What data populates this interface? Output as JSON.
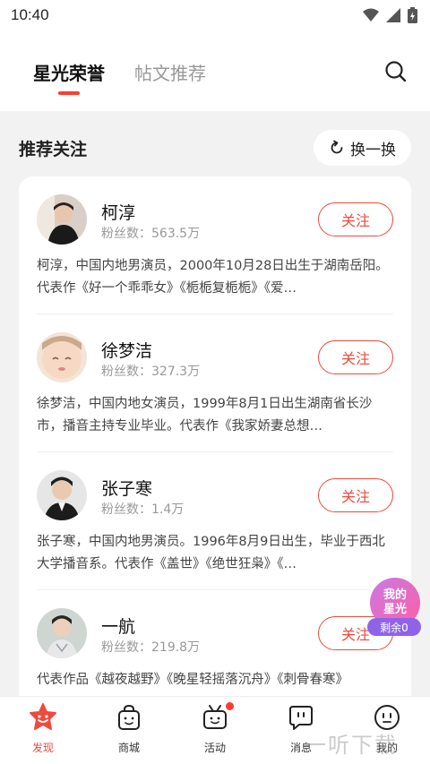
{
  "status_bar": {
    "time": "10:40"
  },
  "header": {
    "tabs": [
      {
        "label": "星光荣誉"
      },
      {
        "label": "帖文推荐"
      }
    ]
  },
  "section": {
    "title": "推荐关注",
    "refresh_label": "换一换"
  },
  "people": [
    {
      "name": "柯淳",
      "fans": "粉丝数：563.5万",
      "follow_label": "关注",
      "bio": "柯淳，中国内地男演员，2000年10月28日出生于湖南岳阳。代表作《好一个乖乖女》《栀栀复栀栀》《爱…"
    },
    {
      "name": "徐梦洁",
      "fans": "粉丝数：327.3万",
      "follow_label": "关注",
      "bio": "徐梦洁，中国内地女演员，1999年8月1日出生湖南省长沙市，播音主持专业毕业。代表作《我家娇妻总想…"
    },
    {
      "name": "张子寒",
      "fans": "粉丝数：1.4万",
      "follow_label": "关注",
      "bio": "张子寒，中国内地男演员。1996年8月9日出生，毕业于西北大学播音系。代表作《盖世》《绝世狂枭》《…"
    },
    {
      "name": "一航",
      "fans": "粉丝数：219.8万",
      "follow_label": "关注",
      "bio": "代表作品《越夜越野》《晚星轻摇落沉舟》《刺骨春寒》"
    }
  ],
  "floating": {
    "title": "我的星光",
    "remain": "剩余0"
  },
  "bottom_nav": [
    {
      "label": "发现",
      "icon": "discover-icon"
    },
    {
      "label": "商城",
      "icon": "shop-bag-icon"
    },
    {
      "label": "活动",
      "icon": "activity-tv-icon"
    },
    {
      "label": "消息",
      "icon": "message-icon"
    },
    {
      "label": "我的",
      "icon": "profile-icon"
    }
  ],
  "watermark": "一听下载",
  "colors": {
    "accent": "#ef4a3c",
    "badge_gradient_start": "#c979e6",
    "badge_gradient_end": "#ff5fa2",
    "remain_bg": "#8f63e8"
  }
}
